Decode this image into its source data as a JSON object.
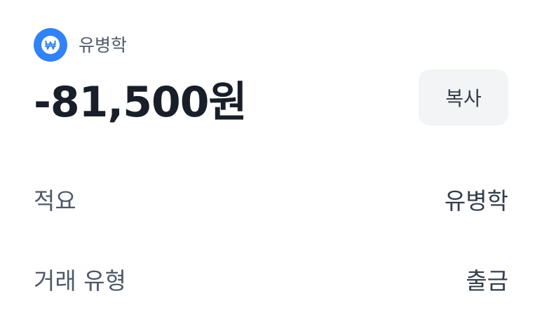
{
  "account": {
    "name": "유병학",
    "icon": "won-sign-icon",
    "icon_glyph": "₩",
    "icon_color": "#3182f6"
  },
  "transaction": {
    "amount": "-81,500원"
  },
  "actions": {
    "copy_label": "복사"
  },
  "details": {
    "memo": {
      "label": "적요",
      "value": "유병학"
    },
    "type": {
      "label": "거래 유형",
      "value": "출금"
    }
  }
}
